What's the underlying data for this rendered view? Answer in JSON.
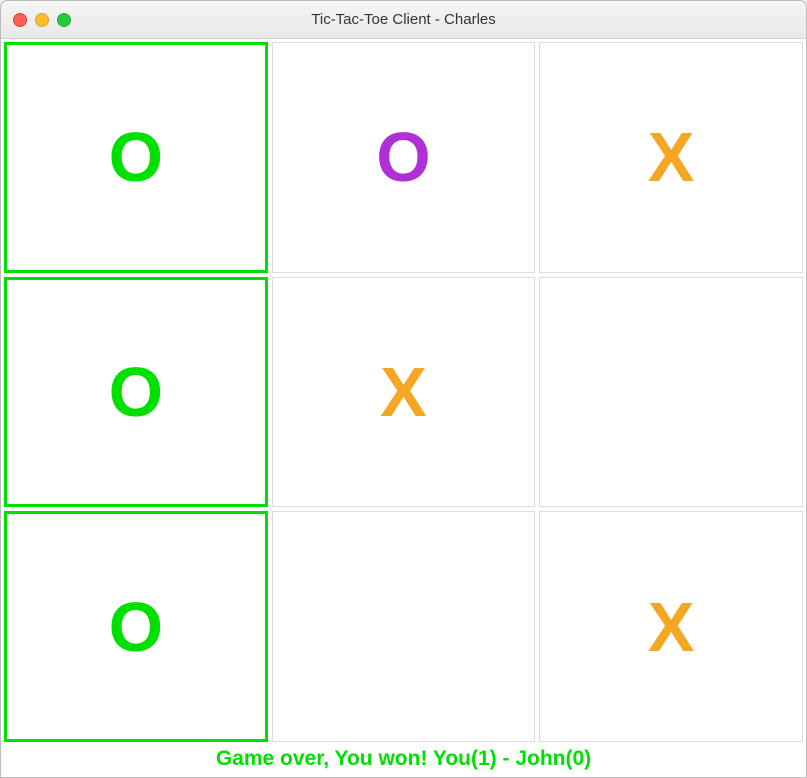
{
  "window": {
    "title": "Tic-Tac-Toe Client - Charles"
  },
  "board": {
    "cells": [
      {
        "mark": "O",
        "color": "o-green",
        "win": true
      },
      {
        "mark": "O",
        "color": "o-purple",
        "win": false
      },
      {
        "mark": "X",
        "color": "x-orange",
        "win": false
      },
      {
        "mark": "O",
        "color": "o-green",
        "win": true
      },
      {
        "mark": "X",
        "color": "x-orange",
        "win": false
      },
      {
        "mark": "",
        "color": "",
        "win": false
      },
      {
        "mark": "O",
        "color": "o-green",
        "win": true
      },
      {
        "mark": "",
        "color": "",
        "win": false
      },
      {
        "mark": "X",
        "color": "x-orange",
        "win": false
      }
    ]
  },
  "colors": {
    "win_border": "#00e000",
    "o_green": "#00e000",
    "o_purple": "#b030d8",
    "x_orange": "#f5a623",
    "status_text": "#00e000"
  },
  "status": {
    "message": "Game over, You won! You(1) - John(0)"
  }
}
